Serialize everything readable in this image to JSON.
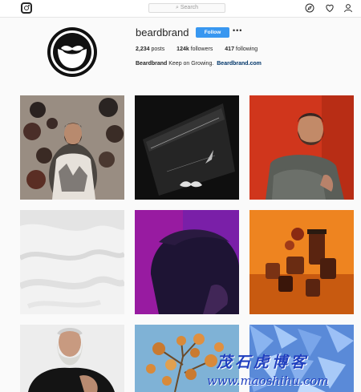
{
  "header": {
    "search_placeholder": "Search",
    "icons": [
      "instagram-logo-icon",
      "search-icon",
      "compass-icon",
      "heart-icon",
      "person-icon"
    ]
  },
  "profile": {
    "username": "beardbrand",
    "follow_label": "Follow",
    "more_label": "•••",
    "posts_count": "2,234",
    "posts_label": "posts",
    "followers_count": "124k",
    "followers_label": "followers",
    "following_count": "417",
    "following_label": "following",
    "bio_name": "Beardbrand",
    "bio_text": "Keep on Growing.",
    "bio_link": "Beardbrand.com"
  },
  "posts": [
    {
      "subject": "man-with-hats-wall"
    },
    {
      "subject": "glass-bottle-dark"
    },
    {
      "subject": "man-red-background"
    },
    {
      "subject": "white-cream-texture"
    },
    {
      "subject": "man-purple-light"
    },
    {
      "subject": "products-orange"
    },
    {
      "subject": "gray-beard-man"
    },
    {
      "subject": "autumn-tree"
    },
    {
      "subject": "blue-crystals"
    }
  ],
  "watermark": {
    "text": "茂石虎博客",
    "url": "www.maoshihu.com"
  },
  "colors": {
    "follow_button": "#3897f0",
    "link": "#003569",
    "watermark": "#1f3fbf"
  }
}
